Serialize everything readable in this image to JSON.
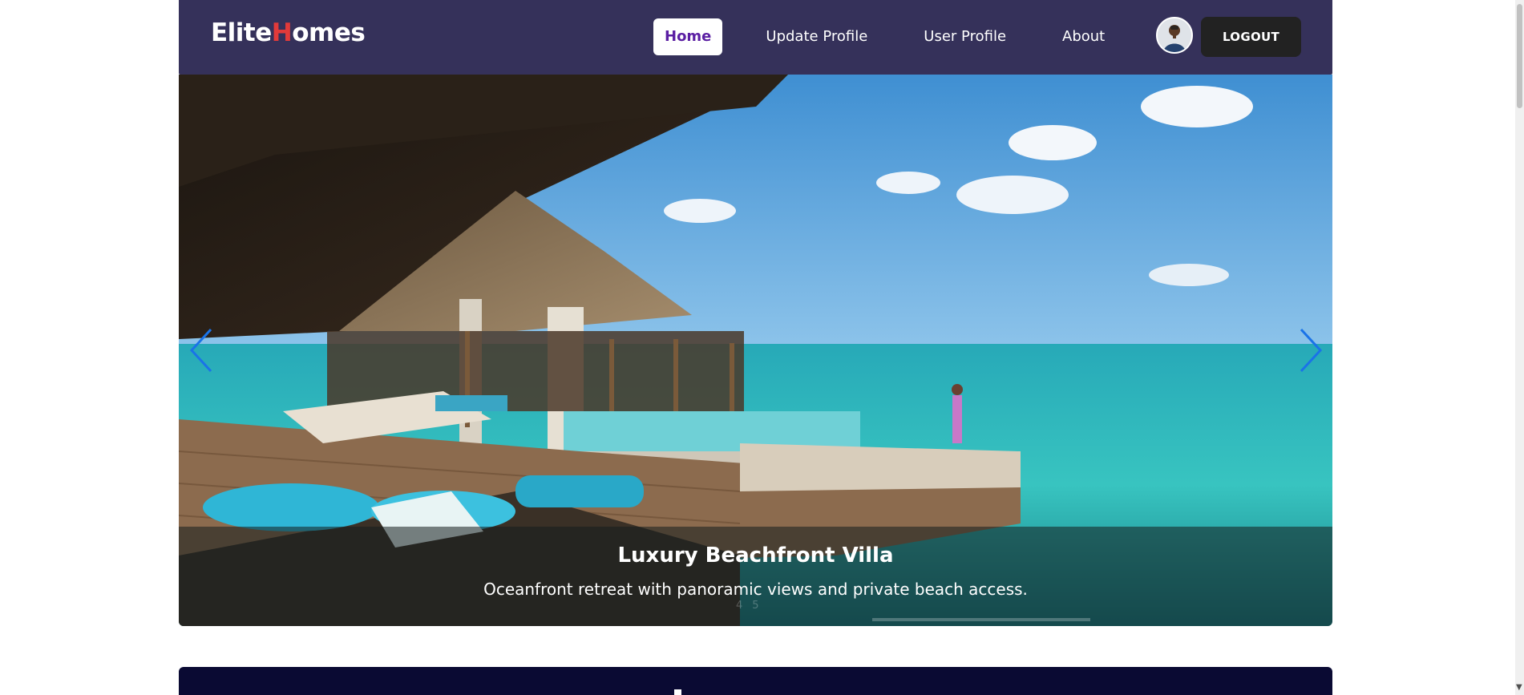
{
  "brand": {
    "part1": "Elite",
    "part2": "H",
    "part3": "omes"
  },
  "nav": {
    "items": [
      {
        "label": "Home",
        "active": true
      },
      {
        "label": "Update Profile",
        "active": false
      },
      {
        "label": "User Profile",
        "active": false
      },
      {
        "label": "About",
        "active": false
      }
    ],
    "logout_label": "LOGOUT"
  },
  "carousel": {
    "title": "Luxury Beachfront Villa",
    "subtitle": "Oceanfront retreat with panoramic views and private beach access.",
    "indicators": [
      "4",
      "5"
    ],
    "autoplay_progress": 0.0
  },
  "colors": {
    "navbar": "#35315a",
    "brand_accent": "#e23a3a",
    "active_link_text": "#5b1fa3",
    "arrow": "#1a73e8"
  },
  "icons": {
    "prev": "chevron-left-icon",
    "next": "chevron-right-icon"
  }
}
